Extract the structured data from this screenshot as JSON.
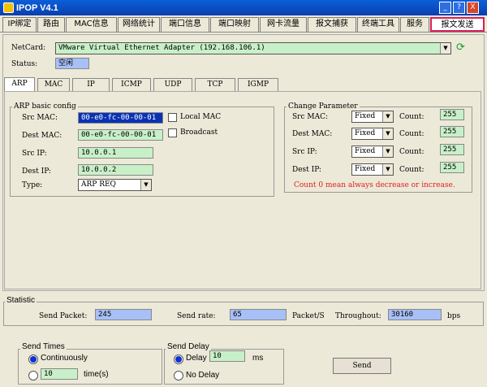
{
  "window": {
    "title": "IPOP V4.1",
    "help": "?",
    "min": "_",
    "close": "X"
  },
  "tabs": [
    "IP绑定",
    "路由",
    "MAC信息",
    "网络统计",
    "端口信息",
    "端口映射",
    "网卡流量",
    "报文捕获",
    "终端工具",
    "服务",
    "报文发送"
  ],
  "netcard": {
    "label": "NetCard:",
    "value": "VMware Virtual Ethernet Adapter (192.168.106.1)"
  },
  "status": {
    "label": "Status:",
    "value": "空闲"
  },
  "subtabs": [
    "ARP",
    "MAC",
    "IP",
    "ICMP",
    "UDP",
    "TCP",
    "IGMP"
  ],
  "arp": {
    "title": "ARP basic config",
    "src_mac_label": "Src MAC:",
    "src_mac": "00-e0-fc-00-00-01",
    "dest_mac_label": "Dest MAC:",
    "dest_mac": "00-e0-fc-00-00-01",
    "local_mac_label": "Local MAC",
    "broadcast_label": "Broadcast",
    "src_ip_label": "Src IP:",
    "src_ip": "10.0.0.1",
    "dest_ip_label": "Dest IP:",
    "dest_ip": "10.0.0.2",
    "type_label": "Type:",
    "type_value": "ARP REQ"
  },
  "change": {
    "title": "Change Parameter",
    "rows": [
      {
        "label": "Src MAC:",
        "mode": "Fixed",
        "count_label": "Count:",
        "count": "255"
      },
      {
        "label": "Dest MAC:",
        "mode": "Fixed",
        "count_label": "Count:",
        "count": "255"
      },
      {
        "label": "Src IP:",
        "mode": "Fixed",
        "count_label": "Count:",
        "count": "255"
      },
      {
        "label": "Dest IP:",
        "mode": "Fixed",
        "count_label": "Count:",
        "count": "255"
      }
    ],
    "note": "Count 0 mean always decrease or increase."
  },
  "statistic": {
    "title": "Statistic",
    "send_packet_label": "Send Packet:",
    "send_packet": "245",
    "send_rate_label": "Send rate:",
    "send_rate": "65",
    "rate_unit": "Packet/S",
    "throughput_label": "Throughout:",
    "throughput": "30160",
    "throughput_unit": "bps"
  },
  "send_times": {
    "title": "Send Times",
    "continuously": "Continuously",
    "count": "10",
    "unit": "time(s)"
  },
  "send_delay": {
    "title": "Send Delay",
    "delay": "Delay",
    "delay_value": "10",
    "unit": "ms",
    "no_delay": "No Delay"
  },
  "send_button": "Send",
  "colors": {
    "title_bar": "#0a3fb0",
    "active_tab_border": "#d81e5b",
    "field_green": "#c8f0c8",
    "field_blue": "#a8c0f8",
    "note_red": "#e02020"
  }
}
